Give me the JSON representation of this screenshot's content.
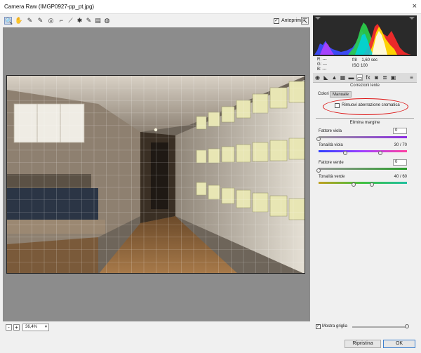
{
  "window": {
    "title": "Camera Raw (IMGP0927-pp_pt.jpg)",
    "close_glyph": "×"
  },
  "toolbar": {
    "tools": [
      {
        "name": "zoom-tool-icon",
        "glyph": "🔍"
      },
      {
        "name": "hand-tool-icon",
        "glyph": "✋"
      },
      {
        "name": "white-balance-tool-icon",
        "glyph": "✎"
      },
      {
        "name": "color-sampler-tool-icon",
        "glyph": "✎"
      },
      {
        "name": "targeted-adjustment-tool-icon",
        "glyph": "◎"
      },
      {
        "name": "crop-tool-icon",
        "glyph": "⌐"
      },
      {
        "name": "straighten-tool-icon",
        "glyph": "⟋"
      },
      {
        "name": "spot-removal-tool-icon",
        "glyph": "✱"
      },
      {
        "name": "adjustment-brush-icon",
        "glyph": "✎"
      },
      {
        "name": "graduated-filter-icon",
        "glyph": "▤"
      },
      {
        "name": "radial-filter-icon",
        "glyph": "◍"
      }
    ],
    "preview_label": "Anteprima",
    "preview_checked": true,
    "fullscreen_glyph": "⇱"
  },
  "zoom": {
    "minus": "-",
    "plus": "+",
    "value": "36,4%"
  },
  "info": {
    "r": "R:",
    "g": "G:",
    "b": "B:",
    "dash": "---",
    "aperture": "f/8",
    "shutter": "1,60 sec",
    "iso": "ISO 100"
  },
  "panel": {
    "title": "Correzioni lente",
    "tab_colori": "Colori",
    "tab_manuale": "Manuale",
    "remove_ca_label": "Rimuovi aberrazione cromatica",
    "remove_ca_checked": false,
    "defringe_title": "Elimina margine",
    "sliders": {
      "purple_amount": {
        "label": "Fattore viola",
        "value": "0"
      },
      "purple_hue": {
        "label": "Tonalità viola",
        "value": "30 / 70",
        "low": 30,
        "high": 70
      },
      "green_amount": {
        "label": "Fattore verde",
        "value": "0"
      },
      "green_hue": {
        "label": "Tonalità verde",
        "value": "40 / 60",
        "low": 40,
        "high": 60
      }
    }
  },
  "footer": {
    "grid_label": "Mostra griglia",
    "grid_checked": true,
    "grid_size": 0.97,
    "restore_label": "Ripristina",
    "ok_label": "OK"
  }
}
